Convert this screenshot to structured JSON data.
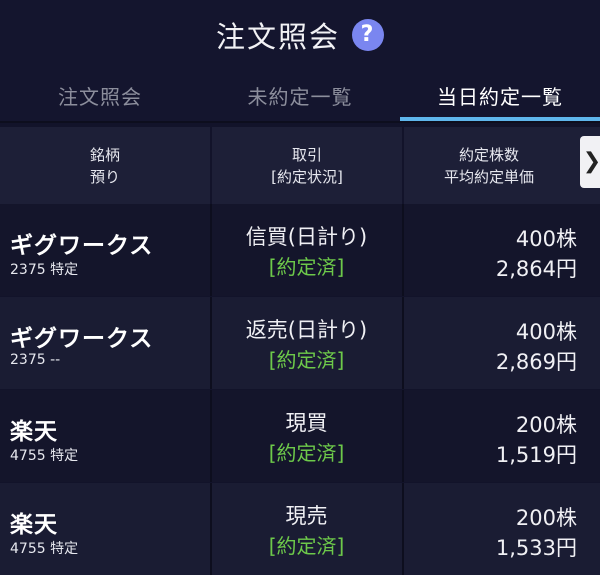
{
  "header": {
    "title": "注文照会",
    "help_icon": "question-circle-icon"
  },
  "tabs": [
    {
      "label": "注文照会",
      "active": false
    },
    {
      "label": "未約定一覧",
      "active": false
    },
    {
      "label": "当日約定一覧",
      "active": true
    }
  ],
  "colors": {
    "accent": "#5fb6ec",
    "status_green": "#6dc94a",
    "help": "#7a86f0"
  },
  "table": {
    "columns": [
      {
        "line1": "銘柄",
        "line2": "預り"
      },
      {
        "line1": "取引",
        "line2": "[約定状況]"
      },
      {
        "line1": "約定株数",
        "line2": "平均約定単価"
      }
    ],
    "next_icon": "chevron-right-icon",
    "rows": [
      {
        "name": "ギグワークス",
        "code_account": "2375 特定",
        "trade": "信買(日計り)",
        "status": "[約定済]",
        "quantity": "400株",
        "price": "2,864円"
      },
      {
        "name": "ギグワークス",
        "code_account": "2375 --",
        "trade": "返売(日計り)",
        "status": "[約定済]",
        "quantity": "400株",
        "price": "2,869円"
      },
      {
        "name": "楽天",
        "code_account": "4755 特定",
        "trade": "現買",
        "status": "[約定済]",
        "quantity": "200株",
        "price": "1,519円"
      },
      {
        "name": "楽天",
        "code_account": "4755 特定",
        "trade": "現売",
        "status": "[約定済]",
        "quantity": "200株",
        "price": "1,533円"
      }
    ]
  }
}
